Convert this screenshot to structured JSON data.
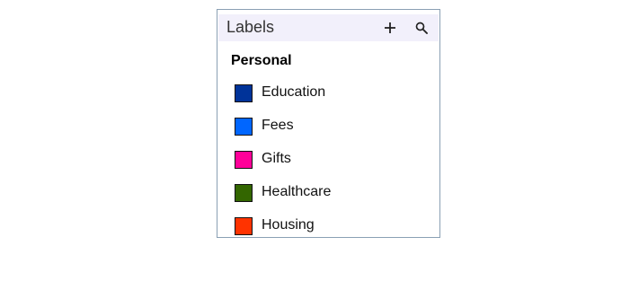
{
  "panel": {
    "title": "Labels",
    "actions": {
      "add": "plus-icon",
      "search": "search-icon"
    }
  },
  "section": {
    "title": "Personal"
  },
  "labels": [
    {
      "name": "Education",
      "color": "#003399"
    },
    {
      "name": "Fees",
      "color": "#0066ff"
    },
    {
      "name": "Gifts",
      "color": "#ff0099"
    },
    {
      "name": "Healthcare",
      "color": "#336600"
    },
    {
      "name": "Housing",
      "color": "#ff3300"
    }
  ]
}
